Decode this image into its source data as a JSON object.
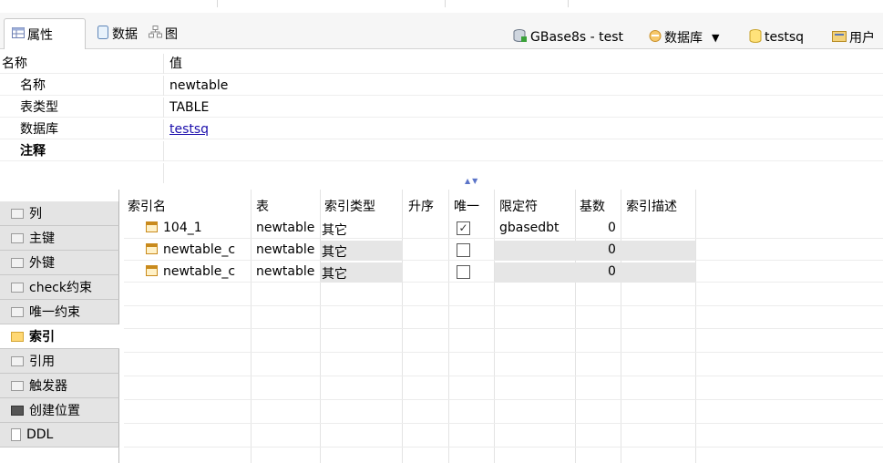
{
  "tabs": [
    {
      "label": "属性",
      "icon": "table-grid-icon"
    },
    {
      "label": "数据",
      "icon": "document-icon"
    },
    {
      "label": "图",
      "icon": "diagram-icon"
    }
  ],
  "context": {
    "connection": "GBase8s - test",
    "database_label": "数据库",
    "schema": "testsq",
    "user_label": "用户"
  },
  "properties": {
    "header_name": "名称",
    "header_value": "值",
    "rows": [
      {
        "label": "名称",
        "value": "newtable"
      },
      {
        "label": "表类型",
        "value": "TABLE"
      },
      {
        "label": "数据库",
        "value": "testsq"
      },
      {
        "label": "注释",
        "value": ""
      }
    ]
  },
  "sidebar": {
    "items": [
      {
        "label": "列",
        "icon": "folder-icon"
      },
      {
        "label": "主键",
        "icon": "folder-icon"
      },
      {
        "label": "外键",
        "icon": "folder-icon"
      },
      {
        "label": "check约束",
        "icon": "folder-icon"
      },
      {
        "label": "唯一约束",
        "icon": "folder-icon"
      },
      {
        "label": "索引",
        "icon": "open-folder-icon"
      },
      {
        "label": "引用",
        "icon": "folder-icon"
      },
      {
        "label": "触发器",
        "icon": "folder-icon"
      },
      {
        "label": "创建位置",
        "icon": "location-icon"
      },
      {
        "label": "DDL",
        "icon": "document-icon"
      }
    ],
    "active": "索引"
  },
  "index_table": {
    "columns": [
      "索引名",
      "表",
      "索引类型",
      "升序",
      "唯一",
      "限定符",
      "基数",
      "索引描述"
    ],
    "rows": [
      {
        "name": "104_1",
        "table": "newtable",
        "type": "其它",
        "asc": "",
        "unique": true,
        "qualifier": "gbasedbt",
        "cardinality": "0",
        "desc": ""
      },
      {
        "name": "newtable_c",
        "table": "newtable",
        "type": "其它",
        "asc": "",
        "unique": false,
        "qualifier": "",
        "cardinality": "0",
        "desc": ""
      },
      {
        "name": "newtable_c",
        "table": "newtable",
        "type": "其它",
        "asc": "",
        "unique": false,
        "qualifier": "",
        "cardinality": "0",
        "desc": ""
      }
    ]
  }
}
